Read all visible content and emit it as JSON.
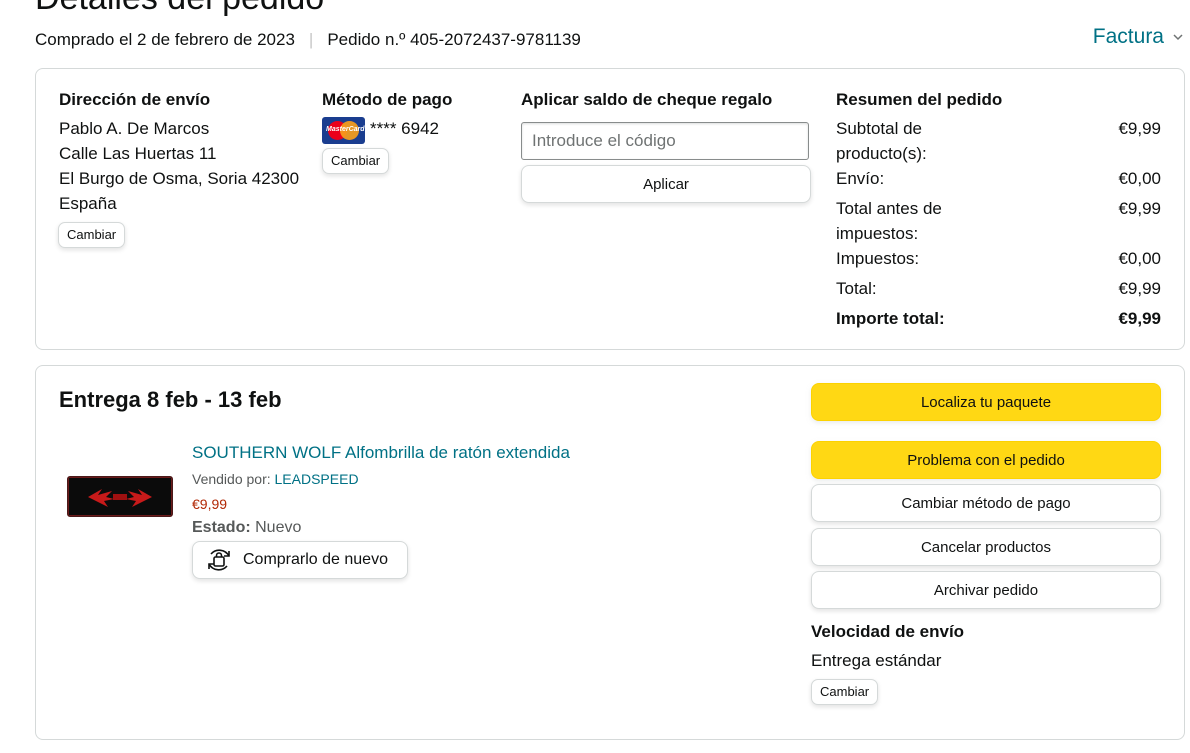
{
  "page": {
    "title": "Detalles del pedido",
    "purchase_date": "Comprado el 2 de febrero de 2023",
    "separator": "|",
    "order_number": "Pedido n.º 405-2072437-9781139",
    "invoice_label": "Factura"
  },
  "shipping": {
    "heading": "Dirección de envío",
    "name": "Pablo A. De Marcos",
    "street": "Calle Las Huertas 11",
    "city": "El Burgo de Osma, Soria 42300",
    "country": "España",
    "change_label": "Cambiar"
  },
  "payment": {
    "heading": "Método de pago",
    "card_brand_icon": "mastercard-icon",
    "card_brand_text": "MasterCard",
    "card_number": "**** 6942",
    "change_label": "Cambiar"
  },
  "gift_card": {
    "heading": "Aplicar saldo de cheque regalo",
    "placeholder": "Introduce el código",
    "apply_label": "Aplicar"
  },
  "summary": {
    "heading": "Resumen del pedido",
    "rows": [
      {
        "label": "Subtotal de producto(s):",
        "value": "€9,99"
      },
      {
        "label": "Envío:",
        "value": "€0,00"
      },
      {
        "label": "Total antes de impuestos:",
        "value": "€9,99"
      },
      {
        "label": "Impuestos:",
        "value": "€0,00"
      },
      {
        "label": "Total:",
        "value": "€9,99"
      }
    ],
    "grand_total_label": "Importe total:",
    "grand_total_value": "€9,99"
  },
  "delivery": {
    "heading": "Entrega 8 feb - 13 feb",
    "product": {
      "title": "SOUTHERN WOLF Alfombrilla de ratón extendida",
      "sold_by_label": "Vendido por:",
      "seller": "LEADSPEED",
      "price": "€9,99",
      "condition_label": "Estado:",
      "condition": "Nuevo",
      "buy_again_label": "Comprarlo de nuevo"
    },
    "actions": {
      "track": "Localiza tu paquete",
      "problem": "Problema con el pedido",
      "change_payment": "Cambiar método de pago",
      "cancel": "Cancelar productos",
      "archive": "Archivar pedido"
    },
    "speed": {
      "heading": "Velocidad de envío",
      "value": "Entrega estándar",
      "change_label": "Cambiar"
    }
  },
  "colors": {
    "link": "#007185",
    "price": "#b12704",
    "primary_button": "#ffd814",
    "border": "#d5d9d9"
  }
}
